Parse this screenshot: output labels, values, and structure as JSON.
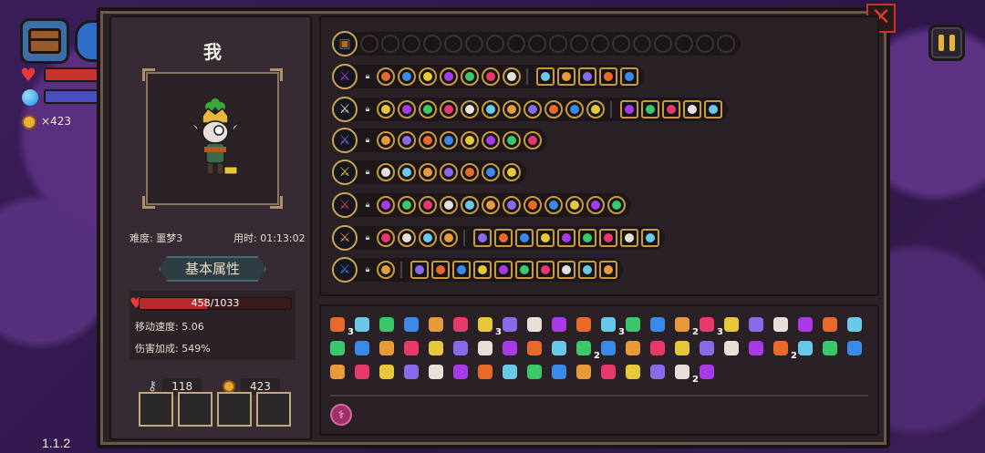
{
  "hud": {
    "gold_count": "×423",
    "version": "1.1.2"
  },
  "player": {
    "name": "我",
    "difficulty": "难度: 噩梦3",
    "time": "用时: 01:13:02",
    "attr_button": "基本属性",
    "hp_text": "458/1033",
    "hp_fraction": 0.443,
    "move_speed": "移动速度: 5.06",
    "damage_bonus": "伤害加成: 549%",
    "keys": "118",
    "coins": "423"
  },
  "colors": {
    "gold_border": "#c89a3c",
    "hp_red": "#b92a2e",
    "frame_bg": "#2b2228",
    "close_red": "#d83a30"
  },
  "weapon_rows": [
    {
      "weapon_icon": "chest-icon",
      "skills": 0
    },
    {
      "weapon_icon": "dark-sword-icon"
    },
    {
      "weapon_icon": "purple-staff-icon"
    },
    {
      "weapon_icon": "violet-wand-icon"
    },
    {
      "weapon_icon": "blue-blade-icon"
    },
    {
      "weapon_icon": "ice-staff-icon"
    },
    {
      "weapon_icon": "shadow-spear-icon"
    },
    {
      "weapon_icon": "rune-scepter-icon"
    }
  ],
  "item_counts": [
    "3",
    "3",
    "3",
    "2",
    "3",
    "2",
    "2",
    "2"
  ]
}
